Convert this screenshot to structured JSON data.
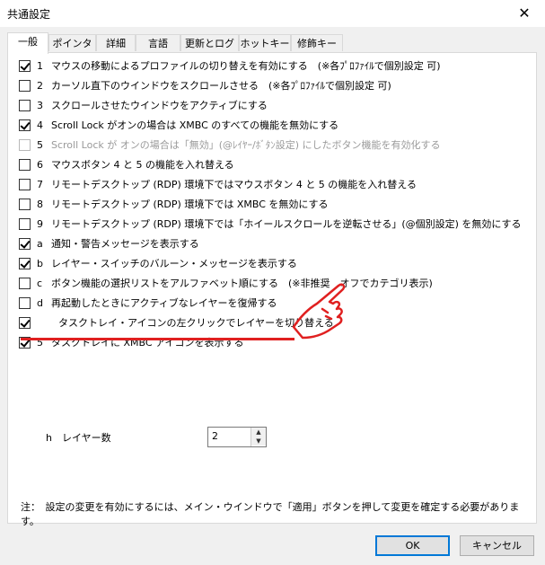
{
  "window": {
    "title": "共通設定",
    "close_glyph": "✕"
  },
  "tabs": [
    "一般",
    "ポインタ",
    "詳細",
    "言語",
    "更新とログ",
    "ホットキー",
    "修飾キー"
  ],
  "options": [
    {
      "key": "1",
      "text": "マウスの移動によるプロファイルの切り替えを有効にする　(※各ﾌﾟﾛﾌｧｲﾙで個別設定 可)",
      "checked": true,
      "disabled": false
    },
    {
      "key": "2",
      "text": "カーソル直下のウインドウをスクロールさせる　(※各ﾌﾟﾛﾌｧｲﾙで個別設定 可)",
      "checked": false,
      "disabled": false
    },
    {
      "key": "3",
      "text": "スクロールさせたウインドウをアクティブにする",
      "checked": false,
      "disabled": false
    },
    {
      "key": "4",
      "text": "Scroll Lock がオンの場合は XMBC のすべての機能を無効にする",
      "checked": true,
      "disabled": false
    },
    {
      "key": "5",
      "text": "Scroll Lock が オンの場合は「無効」(@ﾚｲﾔｰ/ﾎﾞﾀﾝ設定) にしたボタン機能を有効化する",
      "checked": false,
      "disabled": true
    },
    {
      "key": "6",
      "text": "マウスボタン 4 と 5 の機能を入れ替える",
      "checked": false,
      "disabled": false
    },
    {
      "key": "7",
      "text": "リモートデスクトップ (RDP) 環境下ではマウスボタン 4 と 5 の機能を入れ替える",
      "checked": false,
      "disabled": false
    },
    {
      "key": "8",
      "text": "リモートデスクトップ (RDP) 環境下では XMBC を無効にする",
      "checked": false,
      "disabled": false
    },
    {
      "key": "9",
      "text": "リモートデスクトップ (RDP) 環境下では「ホイールスクロールを逆転させる」(@個別設定) を無効にする",
      "checked": false,
      "disabled": false
    },
    {
      "key": "a",
      "text": "通知・警告メッセージを表示する",
      "checked": true,
      "disabled": false
    },
    {
      "key": "b",
      "text": "レイヤー・スイッチのバルーン・メッセージを表示する",
      "checked": true,
      "disabled": false
    },
    {
      "key": "c",
      "text": "ボタン機能の選択リストをアルファベット順にする　(※非推奨　オフでカテゴリ表示)",
      "checked": false,
      "disabled": false
    },
    {
      "key": "d",
      "text": "再起動したときにアクティブなレイヤーを復帰する",
      "checked": false,
      "disabled": false
    },
    {
      "key": "",
      "text": "タスクトレイ・アイコンの左クリックでレイヤーを切り替える",
      "checked": true,
      "disabled": false
    },
    {
      "key": "5",
      "text": "タスクトレイに XMBC アイコンを表示する",
      "checked": true,
      "disabled": false
    }
  ],
  "layer_count": {
    "label": "h　レイヤー数",
    "value": "2"
  },
  "note": "注：　設定の変更を有効にするには、メイン・ウインドウで「適用」ボタンを押して変更を確定する必要があります。",
  "buttons": {
    "ok": "OK",
    "cancel": "キャンセル"
  },
  "annotation": {
    "line_color": "#e02020",
    "hand_icon": "pointing-hand-icon"
  }
}
